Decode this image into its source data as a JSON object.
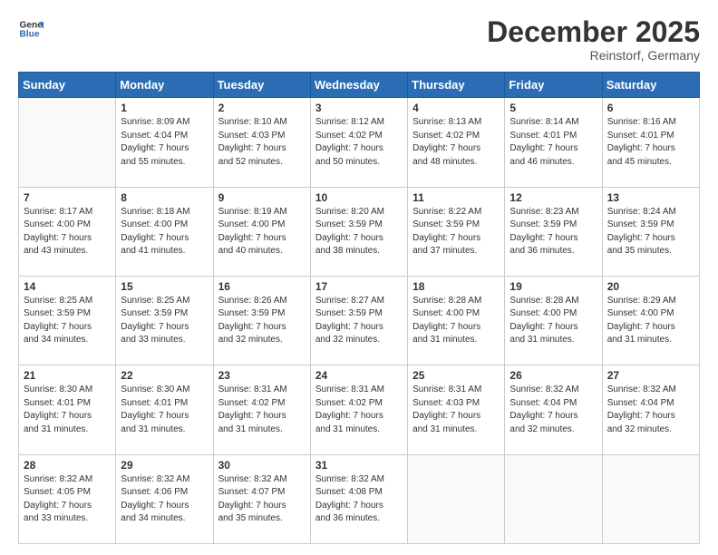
{
  "header": {
    "logo_line1": "General",
    "logo_line2": "Blue",
    "month": "December 2025",
    "location": "Reinstorf, Germany"
  },
  "days_of_week": [
    "Sunday",
    "Monday",
    "Tuesday",
    "Wednesday",
    "Thursday",
    "Friday",
    "Saturday"
  ],
  "weeks": [
    [
      {
        "day": "",
        "info": ""
      },
      {
        "day": "1",
        "info": "Sunrise: 8:09 AM\nSunset: 4:04 PM\nDaylight: 7 hours\nand 55 minutes."
      },
      {
        "day": "2",
        "info": "Sunrise: 8:10 AM\nSunset: 4:03 PM\nDaylight: 7 hours\nand 52 minutes."
      },
      {
        "day": "3",
        "info": "Sunrise: 8:12 AM\nSunset: 4:02 PM\nDaylight: 7 hours\nand 50 minutes."
      },
      {
        "day": "4",
        "info": "Sunrise: 8:13 AM\nSunset: 4:02 PM\nDaylight: 7 hours\nand 48 minutes."
      },
      {
        "day": "5",
        "info": "Sunrise: 8:14 AM\nSunset: 4:01 PM\nDaylight: 7 hours\nand 46 minutes."
      },
      {
        "day": "6",
        "info": "Sunrise: 8:16 AM\nSunset: 4:01 PM\nDaylight: 7 hours\nand 45 minutes."
      }
    ],
    [
      {
        "day": "7",
        "info": "Sunrise: 8:17 AM\nSunset: 4:00 PM\nDaylight: 7 hours\nand 43 minutes."
      },
      {
        "day": "8",
        "info": "Sunrise: 8:18 AM\nSunset: 4:00 PM\nDaylight: 7 hours\nand 41 minutes."
      },
      {
        "day": "9",
        "info": "Sunrise: 8:19 AM\nSunset: 4:00 PM\nDaylight: 7 hours\nand 40 minutes."
      },
      {
        "day": "10",
        "info": "Sunrise: 8:20 AM\nSunset: 3:59 PM\nDaylight: 7 hours\nand 38 minutes."
      },
      {
        "day": "11",
        "info": "Sunrise: 8:22 AM\nSunset: 3:59 PM\nDaylight: 7 hours\nand 37 minutes."
      },
      {
        "day": "12",
        "info": "Sunrise: 8:23 AM\nSunset: 3:59 PM\nDaylight: 7 hours\nand 36 minutes."
      },
      {
        "day": "13",
        "info": "Sunrise: 8:24 AM\nSunset: 3:59 PM\nDaylight: 7 hours\nand 35 minutes."
      }
    ],
    [
      {
        "day": "14",
        "info": "Sunrise: 8:25 AM\nSunset: 3:59 PM\nDaylight: 7 hours\nand 34 minutes."
      },
      {
        "day": "15",
        "info": "Sunrise: 8:25 AM\nSunset: 3:59 PM\nDaylight: 7 hours\nand 33 minutes."
      },
      {
        "day": "16",
        "info": "Sunrise: 8:26 AM\nSunset: 3:59 PM\nDaylight: 7 hours\nand 32 minutes."
      },
      {
        "day": "17",
        "info": "Sunrise: 8:27 AM\nSunset: 3:59 PM\nDaylight: 7 hours\nand 32 minutes."
      },
      {
        "day": "18",
        "info": "Sunrise: 8:28 AM\nSunset: 4:00 PM\nDaylight: 7 hours\nand 31 minutes."
      },
      {
        "day": "19",
        "info": "Sunrise: 8:28 AM\nSunset: 4:00 PM\nDaylight: 7 hours\nand 31 minutes."
      },
      {
        "day": "20",
        "info": "Sunrise: 8:29 AM\nSunset: 4:00 PM\nDaylight: 7 hours\nand 31 minutes."
      }
    ],
    [
      {
        "day": "21",
        "info": "Sunrise: 8:30 AM\nSunset: 4:01 PM\nDaylight: 7 hours\nand 31 minutes."
      },
      {
        "day": "22",
        "info": "Sunrise: 8:30 AM\nSunset: 4:01 PM\nDaylight: 7 hours\nand 31 minutes."
      },
      {
        "day": "23",
        "info": "Sunrise: 8:31 AM\nSunset: 4:02 PM\nDaylight: 7 hours\nand 31 minutes."
      },
      {
        "day": "24",
        "info": "Sunrise: 8:31 AM\nSunset: 4:02 PM\nDaylight: 7 hours\nand 31 minutes."
      },
      {
        "day": "25",
        "info": "Sunrise: 8:31 AM\nSunset: 4:03 PM\nDaylight: 7 hours\nand 31 minutes."
      },
      {
        "day": "26",
        "info": "Sunrise: 8:32 AM\nSunset: 4:04 PM\nDaylight: 7 hours\nand 32 minutes."
      },
      {
        "day": "27",
        "info": "Sunrise: 8:32 AM\nSunset: 4:04 PM\nDaylight: 7 hours\nand 32 minutes."
      }
    ],
    [
      {
        "day": "28",
        "info": "Sunrise: 8:32 AM\nSunset: 4:05 PM\nDaylight: 7 hours\nand 33 minutes."
      },
      {
        "day": "29",
        "info": "Sunrise: 8:32 AM\nSunset: 4:06 PM\nDaylight: 7 hours\nand 34 minutes."
      },
      {
        "day": "30",
        "info": "Sunrise: 8:32 AM\nSunset: 4:07 PM\nDaylight: 7 hours\nand 35 minutes."
      },
      {
        "day": "31",
        "info": "Sunrise: 8:32 AM\nSunset: 4:08 PM\nDaylight: 7 hours\nand 36 minutes."
      },
      {
        "day": "",
        "info": ""
      },
      {
        "day": "",
        "info": ""
      },
      {
        "day": "",
        "info": ""
      }
    ]
  ]
}
